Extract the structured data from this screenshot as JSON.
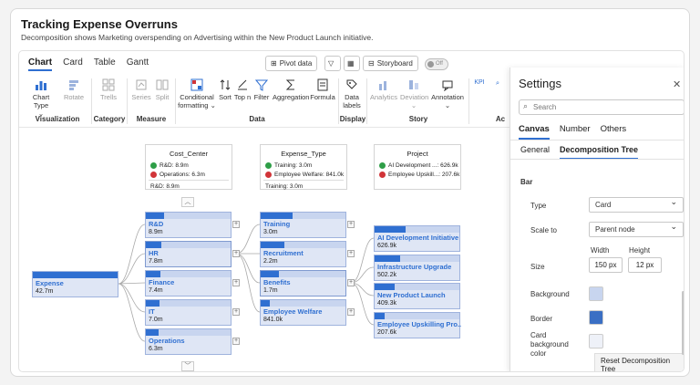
{
  "header": {
    "title": "Tracking Expense Overruns",
    "subtitle": "Decomposition shows Marketing overspending on Advertising within the New Product Launch initiative."
  },
  "ribbon": {
    "tabs": [
      "Chart",
      "Card",
      "Table",
      "Gantt"
    ],
    "pivot_label": "Pivot data",
    "storyboard_label": "Storyboard",
    "toggle_label": "Off",
    "tools": {
      "chart_type": "Chart Type",
      "rotate": "Rotate",
      "trells": "Trells",
      "series": "Series",
      "split": "Split",
      "conditional": "Conditional",
      "formatting": "formatting",
      "sort": "Sort",
      "topn": "Top n",
      "filter": "Filter",
      "aggregation": "Aggregation",
      "formula": "Formula",
      "data": "Data",
      "labels": "labels",
      "analytics": "Analytics",
      "deviation": "Deviation",
      "annotation": "Annotation",
      "kpi": "KPI"
    },
    "groups": [
      "Visualization",
      "Category",
      "Measure",
      "Data",
      "Display",
      "Story",
      "Ac"
    ]
  },
  "filters": [
    {
      "title": "Cost_Center",
      "top": "R&D: 8.9m",
      "bottom": "Operations: 6.3m",
      "selected": "R&D: 8.9m"
    },
    {
      "title": "Expense_Type",
      "top": "Training: 3.0m",
      "bottom": "Employee Welfare: 841.0k",
      "selected": "Training: 3.0m"
    },
    {
      "title": "Project",
      "top": "AI Development ...: 626.9k",
      "bottom": "Employee Upskill...: 207.6k",
      "selected": ""
    }
  ],
  "tree": {
    "root": {
      "label": "Expense",
      "value": "42.7m",
      "fill": 1.0
    },
    "level1": [
      {
        "label": "R&D",
        "value": "8.9m",
        "fill": 0.21
      },
      {
        "label": "HR",
        "value": "7.8m",
        "fill": 0.18
      },
      {
        "label": "Finance",
        "value": "7.4m",
        "fill": 0.17
      },
      {
        "label": "IT",
        "value": "7.0m",
        "fill": 0.16
      },
      {
        "label": "Operations",
        "value": "6.3m",
        "fill": 0.15
      }
    ],
    "level2": [
      {
        "label": "Training",
        "value": "3.0m",
        "fill": 0.38
      },
      {
        "label": "Recruitment",
        "value": "2.2m",
        "fill": 0.28
      },
      {
        "label": "Benefits",
        "value": "1.7m",
        "fill": 0.22
      },
      {
        "label": "Employee Welfare",
        "value": "841.0k",
        "fill": 0.11
      }
    ],
    "level3": [
      {
        "label": "AI Development Initiative",
        "value": "626.9k",
        "fill": 0.37
      },
      {
        "label": "Infrastructure Upgrade",
        "value": "502.2k",
        "fill": 0.3
      },
      {
        "label": "New Product Launch",
        "value": "409.3k",
        "fill": 0.24
      },
      {
        "label": "Employee Upskilling Pro...",
        "value": "207.6k",
        "fill": 0.12
      }
    ]
  },
  "settings": {
    "title": "Settings",
    "search_placeholder": "Search",
    "tabs": [
      "Canvas",
      "Number",
      "Others"
    ],
    "subtabs": [
      "General",
      "Decomposition Tree"
    ],
    "section": "Bar",
    "type_label": "Type",
    "type_value": "Card",
    "scale_label": "Scale to",
    "scale_value": "Parent node",
    "size_label": "Size",
    "width_label": "Width",
    "width_value": "150 px",
    "height_label": "Height",
    "height_value": "12 px",
    "background_label": "Background",
    "border_label": "Border",
    "card_bg_label": "Card background color",
    "reset_label": "Reset Decomposition Tree",
    "colors": {
      "background": "#c8d5ef",
      "border": "#3a6fc4",
      "card_bg": "#eef1f8"
    }
  }
}
